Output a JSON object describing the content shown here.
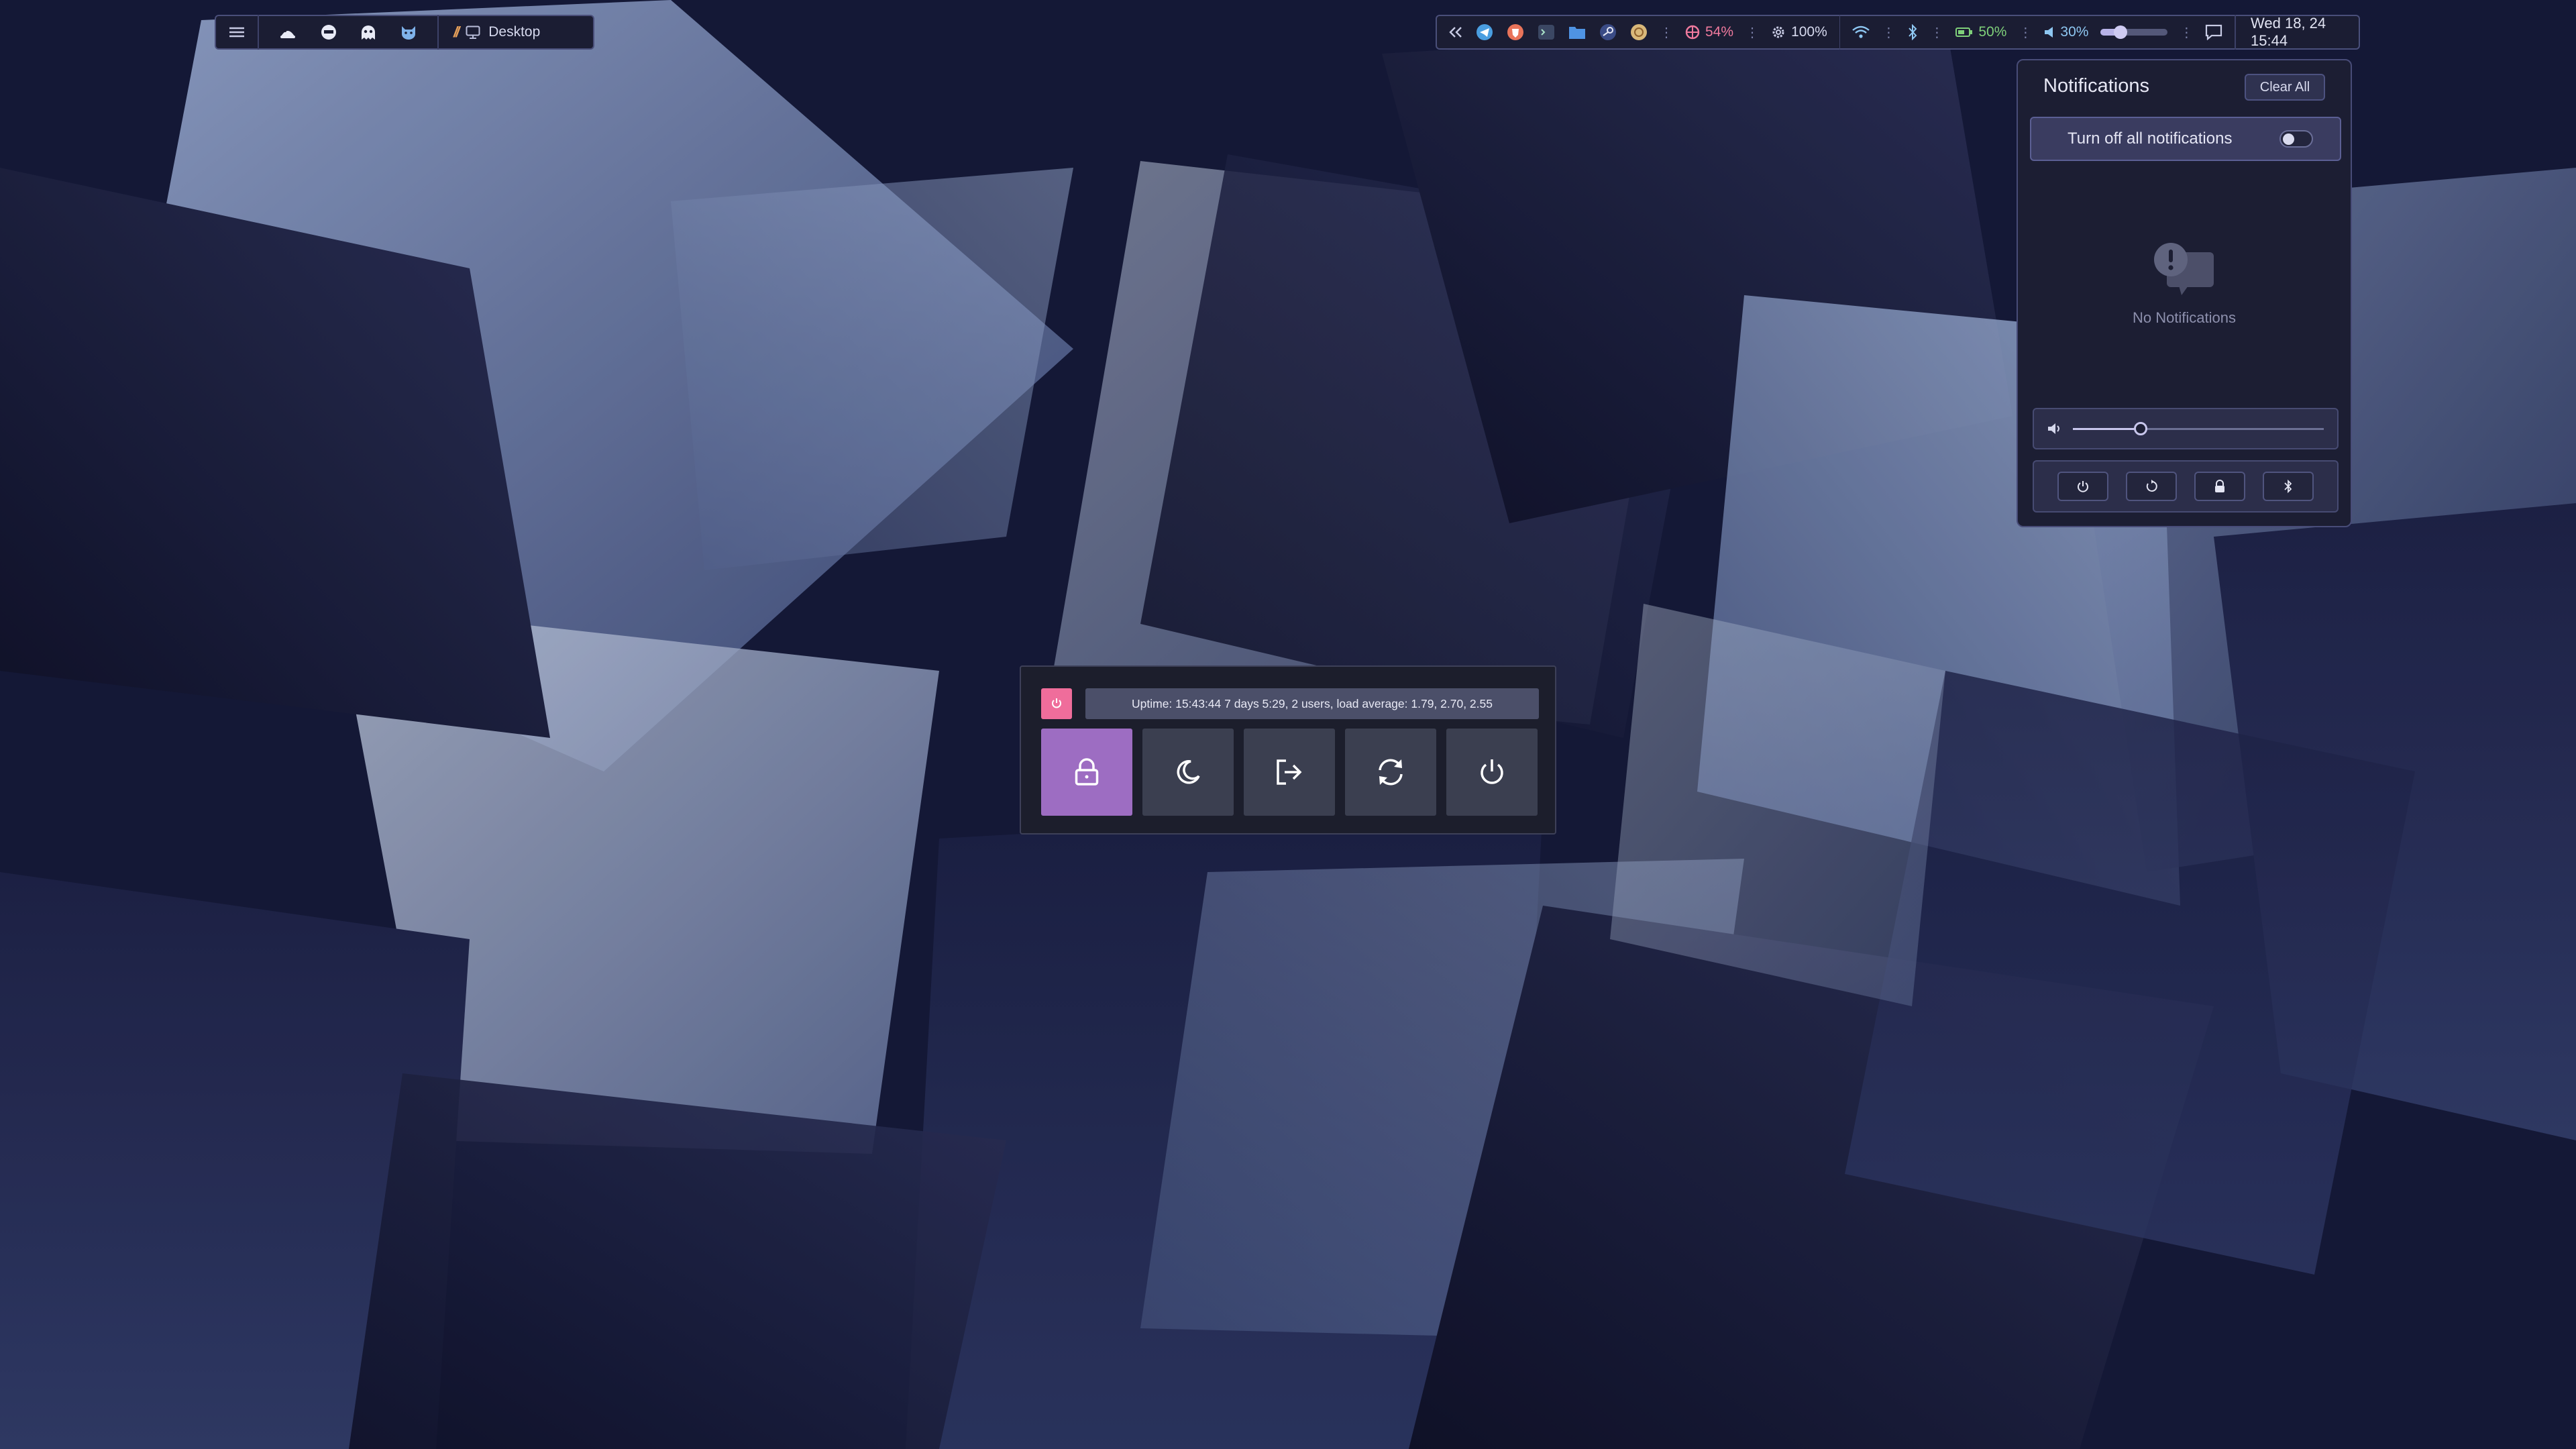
{
  "top_bar": {
    "workspace_icons": [
      "menu-icon",
      "crab-icon",
      "ghost-round-icon",
      "ghost-icon",
      "cat-icon"
    ],
    "window_title_icon": "desktop-icon",
    "window_title": "Desktop",
    "tray_icons": [
      "chevrons-left-icon",
      "telegram-icon",
      "brave-icon",
      "terminal-app-icon",
      "files-icon",
      "steam-icon",
      "element-icon"
    ],
    "cpu_label": "54%",
    "ram_label": "100%",
    "battery_label": "50%",
    "volume_label": "30%",
    "volume_level": 0.3,
    "clock": "Wed 18, 24 15:44",
    "colors": {
      "cpu": "#f07a9e",
      "battery": "#7fd07a",
      "volume": "#8ec7f2",
      "accent": "#9d6dc2"
    }
  },
  "notifications": {
    "title": "Notifications",
    "clear_label": "Clear All",
    "dnd_label": "Turn off all notifications",
    "dnd_enabled": false,
    "empty_icon": "notification-exclamation-icon",
    "empty_text": "No Notifications",
    "volume_level": 0.27,
    "quick_actions": [
      "power-icon",
      "reboot-icon",
      "lock-icon",
      "bluetooth-icon"
    ]
  },
  "power_menu": {
    "uptime_text": "Uptime:  15:43:44  7 days  5:29,  2 users,  load average: 1.79, 2.70, 2.55",
    "buttons": [
      "lock-icon",
      "moon-icon",
      "logout-icon",
      "reboot-icon",
      "power-icon"
    ],
    "selected": "lock-icon"
  }
}
